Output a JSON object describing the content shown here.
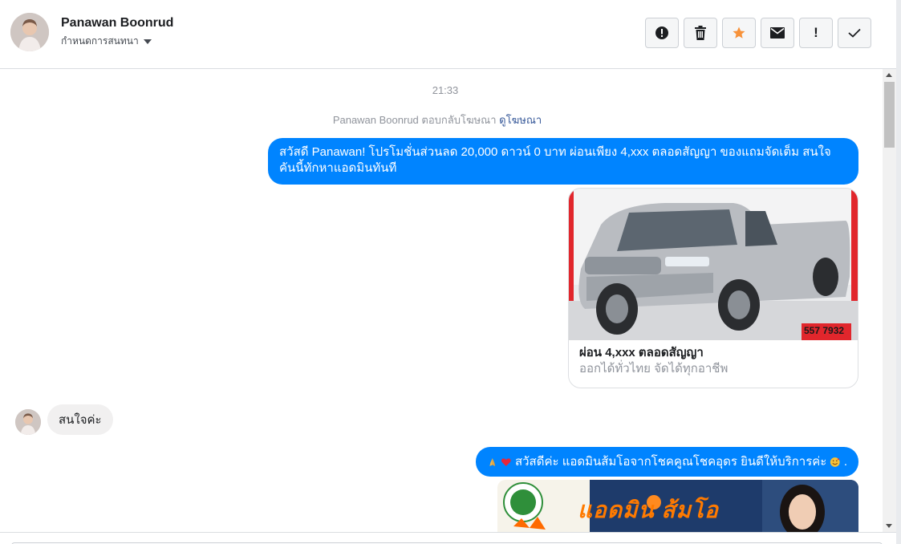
{
  "header": {
    "contact_name": "Panawan Boonrud",
    "settings_label": "กำหนดการสนทนา"
  },
  "toolbar": {
    "buttons": [
      {
        "name": "report-spam",
        "icon": "alert-circle-icon"
      },
      {
        "name": "delete",
        "icon": "trash-icon"
      },
      {
        "name": "star",
        "icon": "star-icon",
        "color": "#f7923a"
      },
      {
        "name": "mark-unread",
        "icon": "envelope-icon"
      },
      {
        "name": "follow-up",
        "icon": "exclamation-icon",
        "label": "!"
      },
      {
        "name": "mark-done",
        "icon": "check-icon"
      }
    ]
  },
  "thread": {
    "timestamp": "21:33",
    "ad_reply": {
      "text": "Panawan Boonrud ตอบกลับโฆษณา",
      "link": "ดูโฆษณา"
    },
    "messages": [
      {
        "direction": "outgoing",
        "text": "สวัสดี Panawan! โปรโมชั่นส่วนลด 20,000 ดาวน์ 0 บาท ผ่อนเพียง 4,xxx ตลอดสัญญา ของแถมจัดเต็ม สนใจคันนี้ทักหาแอดมินทันที"
      },
      {
        "direction": "outgoing",
        "type": "card",
        "title": "ผ่อน 4,xxx ตลอดสัญญา",
        "subtitle": "ออกได้ทั่วไทย จัดได้ทุกอาชีพ",
        "image_overlay_text": "557 7932"
      },
      {
        "direction": "incoming",
        "text": "สนใจค่ะ"
      },
      {
        "direction": "outgoing",
        "text": "สวัสดีค่ะ แอดมินส้มโอจากโชคคูณโชคอุดร ยินดีให้บริการค่ะ",
        "trailing": ".",
        "emojis": [
          "pray-emoji",
          "heart-emoji",
          "smiling-hearts-emoji"
        ]
      },
      {
        "direction": "outgoing",
        "type": "image",
        "banner_text": "แอดมิน ส้มโอ"
      }
    ]
  },
  "colors": {
    "outgoing_bubble": "#0084ff",
    "incoming_bubble": "#f1f0f0",
    "link": "#365899",
    "meta_text": "#90949c"
  }
}
